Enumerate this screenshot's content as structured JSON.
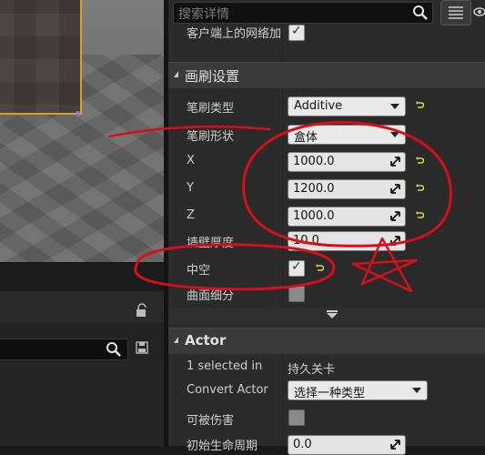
{
  "search": {
    "placeholder": "搜索详情"
  },
  "rows": {
    "net_client": {
      "label": "客户端上的网络加",
      "checked": true
    },
    "brush_type": {
      "label": "笔刷类型",
      "value": "Additive"
    },
    "brush_shape": {
      "label": "笔刷形状",
      "value": "盒体"
    },
    "x": {
      "label": "X",
      "value": "1000.0"
    },
    "y": {
      "label": "Y",
      "value": "1200.0"
    },
    "z": {
      "label": "Z",
      "value": "1000.0"
    },
    "wall_thickness": {
      "label": "墙壁厚度",
      "value": "10.0"
    },
    "hollow": {
      "label": "中空",
      "checked": true
    },
    "tessellated": {
      "label": "曲面细分",
      "checked": false
    },
    "selected": {
      "label": "1 selected in",
      "value": "持久关卡"
    },
    "convert_actor": {
      "label": "Convert Actor",
      "value": "选择一种类型"
    },
    "can_be_damaged": {
      "label": "可被伤害",
      "checked": false
    },
    "initial_life_span": {
      "label": "初始生命周期",
      "value": "0.0"
    }
  },
  "categories": {
    "brush_settings": "画刷设置",
    "actor": "Actor"
  },
  "icons": {
    "search": "search-icon",
    "view_options": "view-options-icon",
    "eye": "eye-icon",
    "lock": "lock-icon",
    "save": "save-icon",
    "reset": "reset-arrow-icon"
  },
  "colors": {
    "selection_outline": "#e39a2a",
    "reset_arrow": "#d8d84a",
    "annotation_red": "#d6101a"
  }
}
